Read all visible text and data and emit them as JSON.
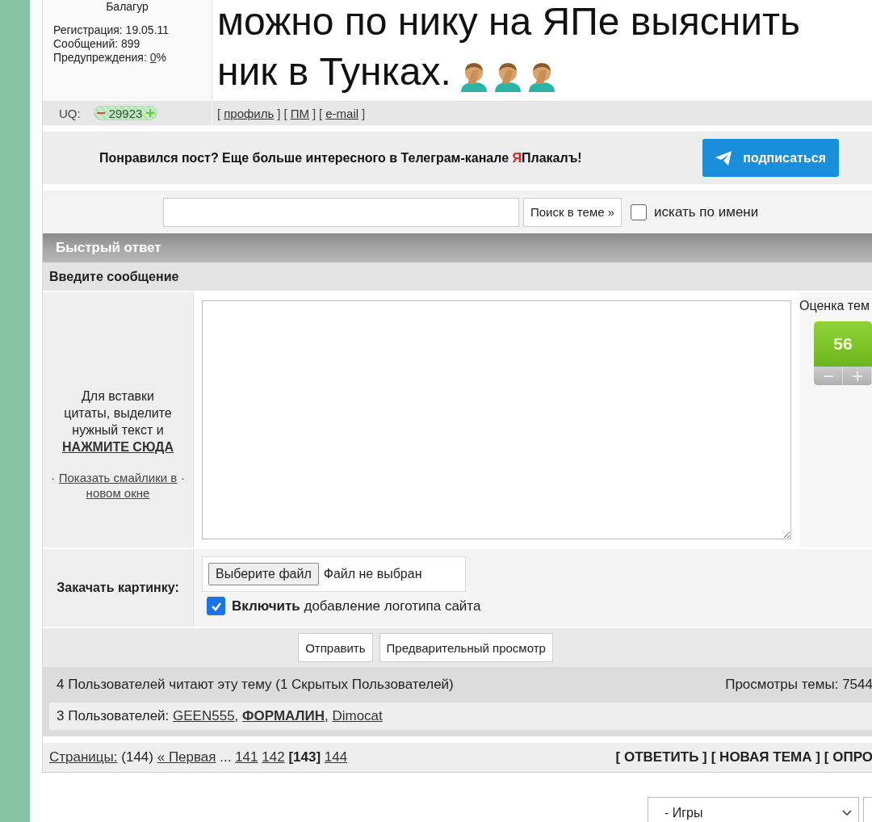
{
  "post": {
    "author_rank": "Балагур",
    "stats": [
      {
        "label": "Регистрация: 19.05.11"
      },
      {
        "label": "Сообщений: 899"
      },
      {
        "label": "Предупреждения: ",
        "link": "0",
        "suffix": "%"
      }
    ],
    "text_lines": [
      "можно по нику на ЯПе выяснить",
      "ник в Тунках."
    ],
    "uq_label": "UQ:",
    "uq_value": "29923",
    "profile_links": [
      {
        "open": "[",
        "label": "профиль",
        "close": "]"
      },
      {
        "open": "[",
        "label": "ПМ",
        "close": "]"
      },
      {
        "open": "[",
        "label": "e-mail",
        "close": "]"
      }
    ]
  },
  "telegram": {
    "text_before": "Понравился пост? Еще больше интересного в Телеграм-канале ",
    "accent": "Я",
    "text_after": "Плакалъ!",
    "button": "подписаться"
  },
  "search": {
    "button": "Поиск в теме »",
    "by_name": {
      "label": "искать по имени",
      "checked": false
    }
  },
  "quick_reply": {
    "title": "Быстрый ответ",
    "subtitle": "Введите сообщение",
    "quote_help": "Для вставки цитаты, выделите нужный текст и",
    "quote_link": "НАЖМИТЕ СЮДА",
    "smiles_bullet_left": "·",
    "smiles_link": "Показать смайлики в новом окне",
    "smiles_bullet_right": "·",
    "rating_label": "Оценка тем",
    "rating_value": "56",
    "upload_label": "Закачать картинку:",
    "file_button": "Выберите файл",
    "file_status": "Файл не выбран",
    "logo": {
      "label": "**Включить** добавление логотипа сайта",
      "checked": true
    },
    "buttons": [
      "Отправить",
      "Предварительный просмотр"
    ]
  },
  "readers": {
    "summary": "4 Пользователей читают эту тему (1 Скрытых Пользователей)",
    "views": "Просмотры темы: 7544",
    "users_label": "3 Пользователей: ",
    "users": [
      {
        "name": "GEEN555",
        "highlighted": false,
        "sep": ", "
      },
      {
        "name": "ФОРМАЛИН",
        "highlighted": true,
        "sep": ", "
      },
      {
        "name": "Dimocat",
        "highlighted": false
      }
    ]
  },
  "pagination": [
    {
      "kind": "link",
      "text": "Страницы:"
    },
    {
      "kind": "text",
      "text": "(144)"
    },
    {
      "kind": "link",
      "text": "« Первая"
    },
    {
      "kind": "text",
      "text": "..."
    },
    {
      "kind": "link",
      "text": "141"
    },
    {
      "kind": "link",
      "text": "142"
    },
    {
      "kind": "current",
      "text": "[143]"
    },
    {
      "kind": "link",
      "text": "144"
    }
  ],
  "actions": [
    "[ ОТВЕТИТЬ ]",
    "[ НОВАЯ ТЕМА ]",
    "[ ОПРО"
  ],
  "forum_select": {
    "value": "- Игры"
  }
}
